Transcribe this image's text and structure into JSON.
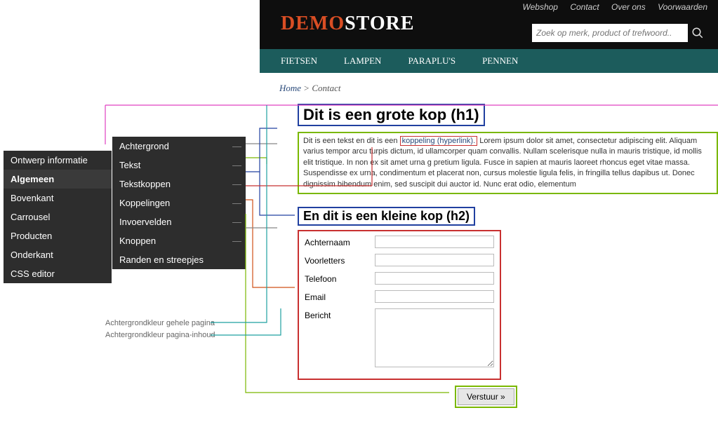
{
  "sidebar_main": {
    "items": [
      {
        "label": "Ontwerp informatie"
      },
      {
        "label": "Algemeen"
      },
      {
        "label": "Bovenkant"
      },
      {
        "label": "Carrousel"
      },
      {
        "label": "Producten"
      },
      {
        "label": "Onderkant"
      },
      {
        "label": "CSS editor"
      }
    ]
  },
  "sidebar_sub": {
    "items": [
      {
        "label": "Achtergrond"
      },
      {
        "label": "Tekst"
      },
      {
        "label": "Tekstkoppen"
      },
      {
        "label": "Koppelingen"
      },
      {
        "label": "Invoervelden"
      },
      {
        "label": "Knoppen"
      },
      {
        "label": "Randen en streepjes"
      }
    ]
  },
  "annotations": {
    "bg_page": "Achtergrondkleur gehele pagina",
    "bg_content": "Achtergrondkleur pagina-inhoud"
  },
  "topnav": {
    "items": [
      "Webshop",
      "Contact",
      "Over ons",
      "Voorwaarden"
    ]
  },
  "logo": {
    "part1": "DEMO",
    "part2": "STORE"
  },
  "search": {
    "placeholder": "Zoek op merk, product of trefwoord.."
  },
  "mainnav": {
    "items": [
      "FIETSEN",
      "LAMPEN",
      "PARAPLU'S",
      "PENNEN"
    ]
  },
  "breadcrumb": {
    "home": "Home",
    "sep": " > ",
    "current": "Contact"
  },
  "heading1": "Dit is een grote kop (h1)",
  "heading2": "En dit is een kleine kop (h2)",
  "paragraph": {
    "pre": "Dit is een tekst en dit is een ",
    "link": "koppeling (hyperlink).",
    "post": " Lorem ipsum dolor sit amet, consectetur adipiscing elit. Aliquam varius tempor arcu turpis dictum, id ullamcorper quam convallis. Nullam scelerisque nulla in mauris tristique, id mollis elit tristique. In non ex sit amet urna g pretium ligula. Fusce in sapien at mauris laoreet rhoncus eget vitae massa. Suspendisse ex urna, condimentum et placerat non, cursus molestie ligula felis, in fringilla tellus dapibus ut. Donec dignissim bibendum enim, sed suscipit dui auctor id. Nunc erat odio, elementum"
  },
  "form": {
    "fields": {
      "lastname": "Achternaam",
      "initials": "Voorletters",
      "phone": "Telefoon",
      "email": "Email",
      "message": "Bericht"
    },
    "submit": "Verstuur »"
  }
}
